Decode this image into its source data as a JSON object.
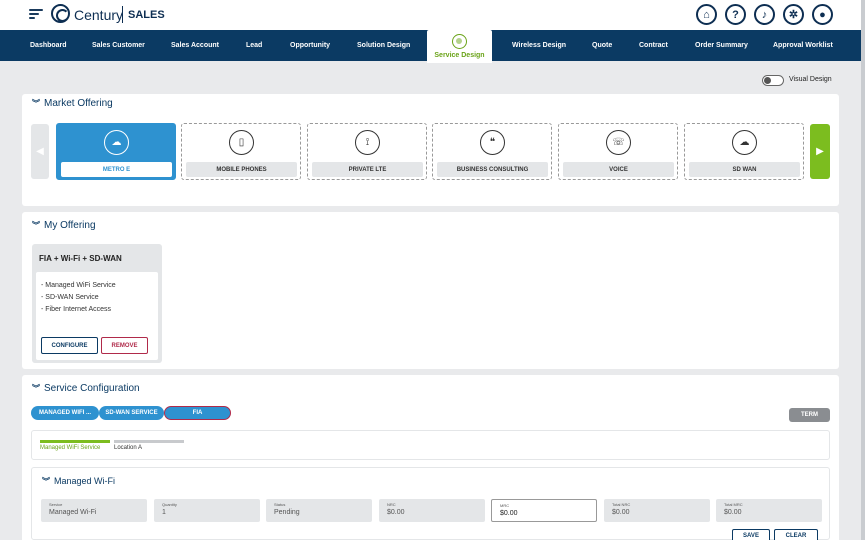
{
  "header": {
    "brand": "Century",
    "app_name": "SALES",
    "icons": [
      "home-icon",
      "help-icon",
      "bell-icon",
      "gear-icon",
      "user-icon"
    ]
  },
  "nav": {
    "items": [
      "Dashboard",
      "Sales Customer",
      "Sales Account",
      "Lead",
      "Opportunity",
      "Solution Design",
      "Service Design",
      "Wireless Design",
      "Quote",
      "Contract",
      "Order Summary",
      "Approval Worklist"
    ],
    "active": "Service Design"
  },
  "toggle": {
    "label": "Visual Design",
    "on": false
  },
  "market_offering": {
    "title": "Market Offering",
    "cards": [
      {
        "label": "METRO E",
        "icon": "cloud-check-icon",
        "active": true
      },
      {
        "label": "MOBILE PHONES",
        "icon": "mobile-phone-icon",
        "active": false
      },
      {
        "label": "PRIVATE LTE",
        "icon": "antenna-icon",
        "active": false
      },
      {
        "label": "BUSINESS CONSULTING",
        "icon": "chat-bubbles-icon",
        "active": false
      },
      {
        "label": "VOICE",
        "icon": "phone-icon",
        "active": false
      },
      {
        "label": "SD WAN",
        "icon": "cloud-network-icon",
        "active": false
      }
    ]
  },
  "my_offering": {
    "title": "My Offering",
    "card_title": "FIA + Wi-Fi + SD-WAN",
    "items": [
      "- Managed WiFi Service",
      "- SD-WAN Service",
      "- Fiber Internet Access"
    ],
    "configure_label": "CONFIGURE",
    "remove_label": "REMOVE"
  },
  "service_config": {
    "title": "Service Configuration",
    "tabs": [
      "MANAGED WIFI ...",
      "SD-WAN SERVICE",
      "FIA"
    ],
    "term_label": "TERM",
    "progress": [
      "Managed WiFi Service",
      "Location A"
    ],
    "managed_wifi": {
      "title": "Managed Wi-Fi",
      "fields": [
        {
          "label": "Service",
          "value": "Managed Wi-Fi",
          "editable": false
        },
        {
          "label": "Quantity",
          "value": "1",
          "editable": false
        },
        {
          "label": "Status",
          "value": "Pending",
          "editable": false
        },
        {
          "label": "NRC",
          "value": "$0.00",
          "editable": false
        },
        {
          "label": "MRC",
          "value": "$0.00",
          "editable": true
        },
        {
          "label": "Total NRC",
          "value": "$0.00",
          "editable": false
        },
        {
          "label": "Total MRC",
          "value": "$0.00",
          "editable": false
        }
      ],
      "save_label": "SAVE",
      "clear_label": "CLEAR"
    }
  },
  "colors": {
    "navy": "#0b3a63",
    "accent_blue": "#2e92d0",
    "accent_green": "#7cbd1f",
    "remove_red": "#b02a4a"
  }
}
